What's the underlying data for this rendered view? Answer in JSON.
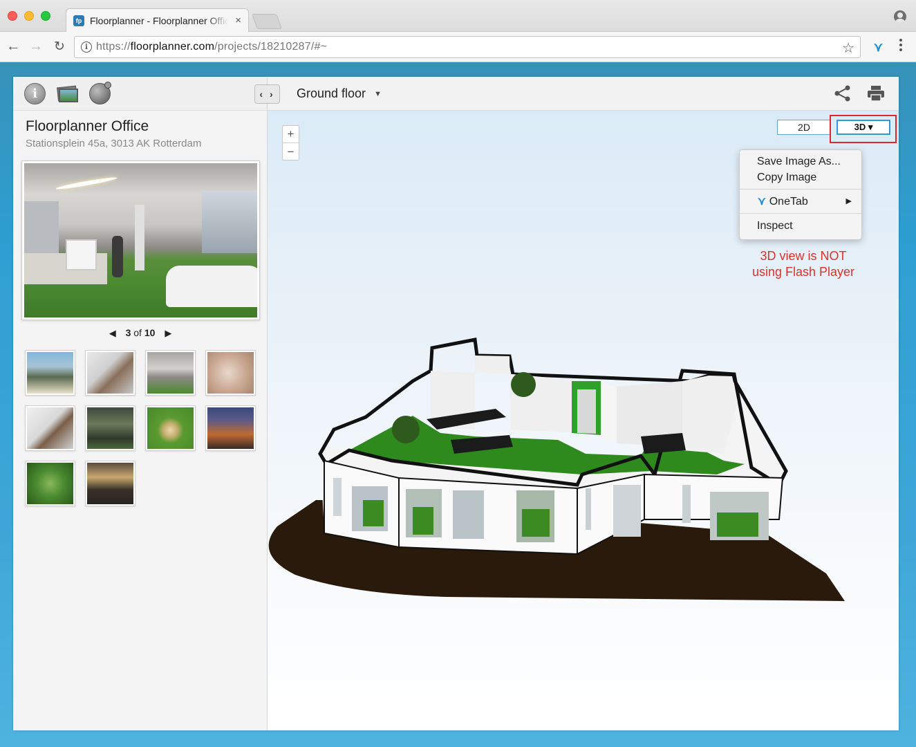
{
  "browser": {
    "tab_title": "Floorplanner - Floorplanner Office",
    "tab_close": "×",
    "favicon": "fp-icon",
    "url_prefix": "https://",
    "url_domain": "floorplanner.com",
    "url_path": "/projects/18210287/#~",
    "icons": [
      "back-arrow-icon",
      "forward-arrow-icon",
      "reload-icon",
      "info-icon",
      "star-icon",
      "onetab-icon",
      "menu-dots-icon",
      "profile-icon"
    ]
  },
  "sidebar": {
    "collapse_label": "‹ ›",
    "project_title": "Floorplanner Office",
    "project_address": "Stationsplein 45a, 3013 AK Rotterdam",
    "pager": {
      "current": "3",
      "of_label": "of",
      "total": "10"
    },
    "thumbnail_count": 10
  },
  "content": {
    "floor_label": "Ground floor",
    "zoom_in": "+",
    "zoom_out": "−",
    "view_2d": "2D",
    "view_3d": "3D ▾"
  },
  "context_menu": {
    "items": [
      "Save Image As...",
      "Copy Image",
      "OneTab",
      "Inspect"
    ]
  },
  "annotation": {
    "line1": "3D view is NOT",
    "line2": "using Flash Player",
    "color": "#e0302a"
  },
  "colors": {
    "page_bg": "#2e9ed1",
    "floor_green": "#2f8a1e",
    "highlight_red": "#e0252d"
  }
}
